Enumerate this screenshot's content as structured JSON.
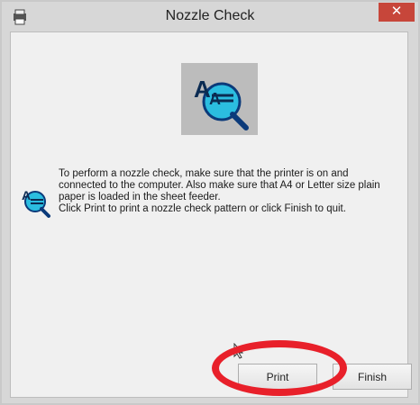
{
  "window": {
    "title": "Nozzle Check",
    "close_glyph": "✕",
    "icon": "printer-icon"
  },
  "dialog": {
    "illustration": "nozzle-check-magnifier-icon",
    "message_lines": [
      "To perform a nozzle check, make sure that the printer is on and",
      "connected to the computer. Also make sure that A4 or Letter size plain",
      "paper is loaded in the sheet feeder.",
      "Click Print to print a nozzle check pattern or click Finish to quit."
    ]
  },
  "buttons": {
    "print": "Print",
    "finish": "Finish"
  },
  "annotation": {
    "color": "#e8202a",
    "target": "print-button"
  }
}
